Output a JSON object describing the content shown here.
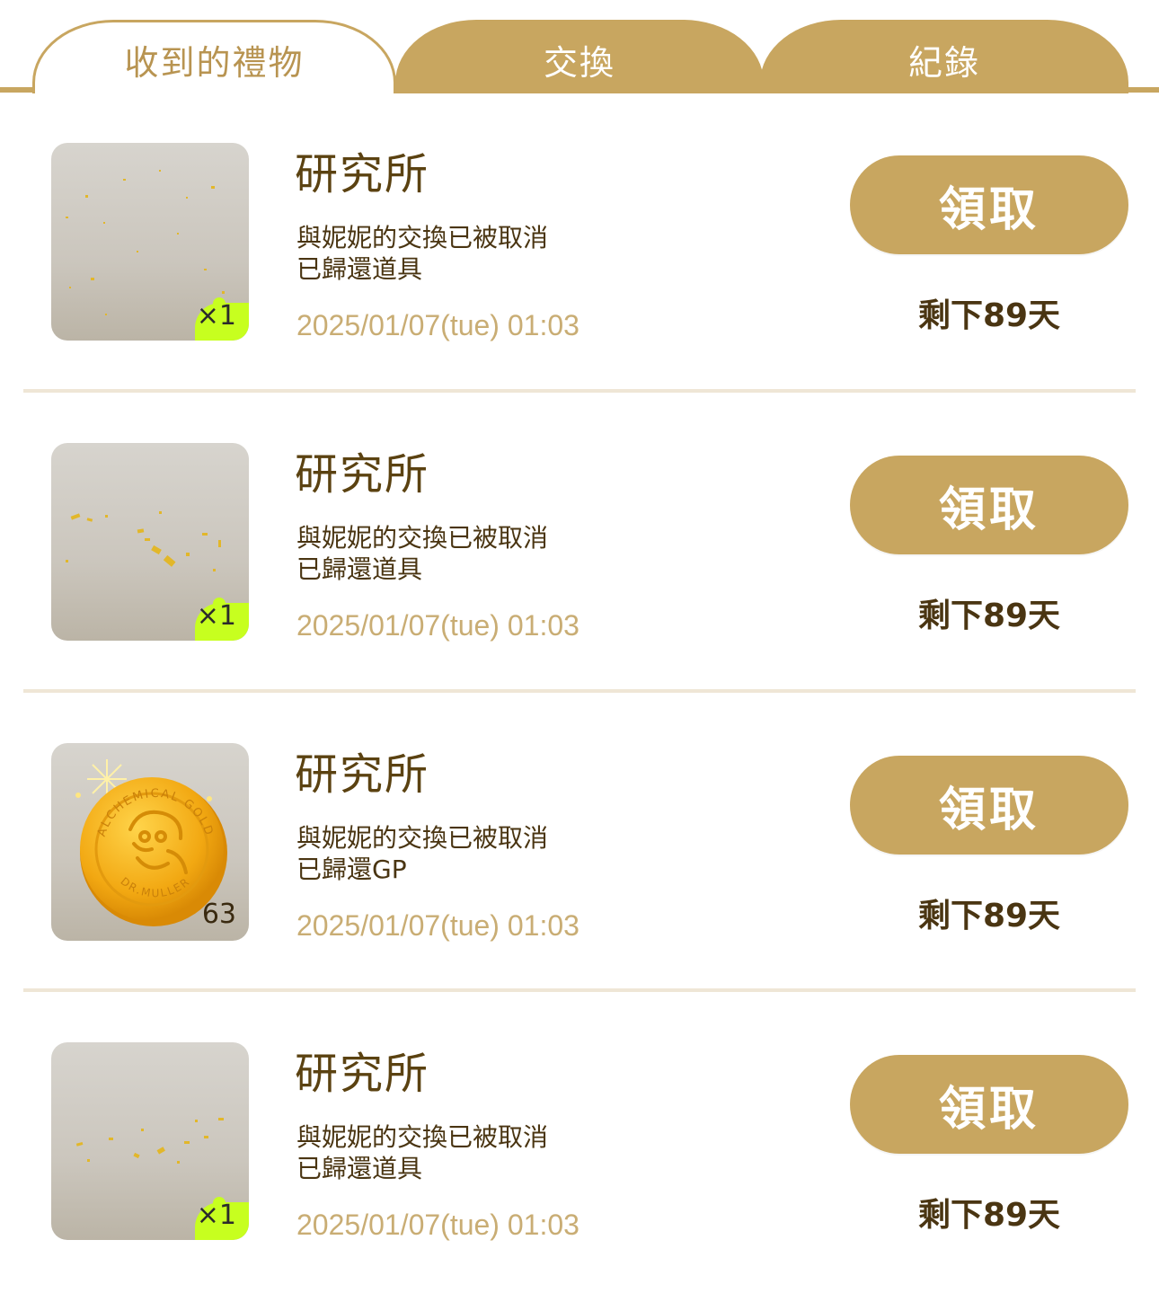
{
  "tabs": {
    "received": "收到的禮物",
    "exchange": "交換",
    "records": "紀錄"
  },
  "items": [
    {
      "title": "研究所",
      "desc_line1": "與妮妮的交換已被取消",
      "desc_line2": "已歸還道具",
      "time": "2025/01/07(tue) 01:03",
      "quantity": "×1",
      "button": "領取",
      "remaining": "剩下89天",
      "thumb_icon": "gold-confetti-icon"
    },
    {
      "title": "研究所",
      "desc_line1": "與妮妮的交換已被取消",
      "desc_line2": "已歸還道具",
      "time": "2025/01/07(tue) 01:03",
      "quantity": "×1",
      "button": "領取",
      "remaining": "剩下89天",
      "thumb_icon": "gold-confetti-icon"
    },
    {
      "title": "研究所",
      "desc_line1": "與妮妮的交換已被取消",
      "desc_line2": "已歸還GP",
      "time": "2025/01/07(tue) 01:03",
      "quantity": "63",
      "button": "領取",
      "remaining": "剩下89天",
      "thumb_icon": "gold-coin-icon",
      "coin_text_top": "ALCHEMICAL GOLD",
      "coin_text_bottom": "DR.MULLER"
    },
    {
      "title": "研究所",
      "desc_line1": "與妮妮的交換已被取消",
      "desc_line2": "已歸還道具",
      "time": "2025/01/07(tue) 01:03",
      "quantity": "×1",
      "button": "領取",
      "remaining": "剩下89天",
      "thumb_icon": "gold-confetti-icon"
    }
  ],
  "colors": {
    "gold": "#c8a660",
    "title_brown": "#5b4211",
    "timestamp": "#c9ad74",
    "badge_green": "#c7ff1f",
    "divider": "#efe6d6"
  }
}
